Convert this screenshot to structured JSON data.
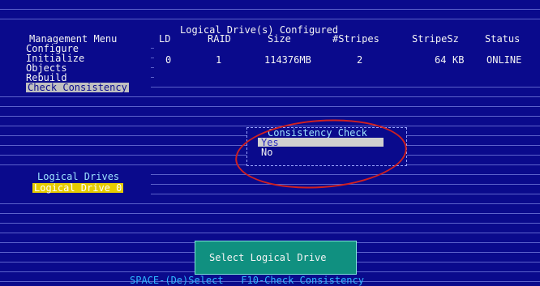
{
  "header": {
    "title": "Logical Drive(s) Configured",
    "menu_label": "Management Menu",
    "columns": [
      "LD",
      "RAID",
      "Size",
      "#Stripes",
      "StripeSz",
      "Status"
    ]
  },
  "menu": {
    "items": [
      {
        "label": "Configure"
      },
      {
        "label": "Initialize"
      },
      {
        "label": "Objects"
      },
      {
        "label": "Rebuild"
      },
      {
        "label": "Check Consistency"
      }
    ]
  },
  "row": {
    "ld": "0",
    "raid": "1",
    "size": "114376MB",
    "stripes": "2",
    "stripesz": "64",
    "stripesz_unit": "KB",
    "status": "ONLINE"
  },
  "dialog": {
    "title": "Consistency Check",
    "yes": "Yes",
    "no": "No"
  },
  "drives": {
    "label": "Logical Drives",
    "selected": "Logical Drive 0"
  },
  "select_box": {
    "label": "Select Logical Drive"
  },
  "statusbar": {
    "text": "SPACE-(De)Select   F10-Check Consistency"
  },
  "colors": {
    "background": "#0a0a8c",
    "highlight": "#c0c0c0",
    "select_box": "#109080",
    "annotation": "#d02020"
  }
}
